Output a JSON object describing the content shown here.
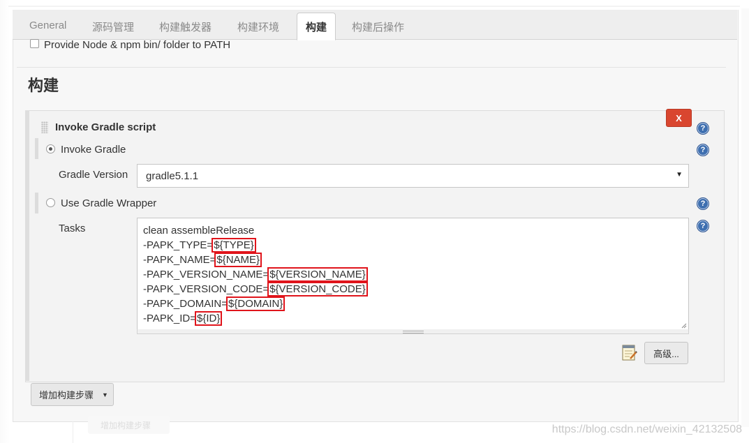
{
  "tabs": [
    "General",
    "源码管理",
    "构建触发器",
    "构建环境",
    "构建",
    "构建后操作"
  ],
  "active_tab_index": 4,
  "env_option": {
    "label": "Provide Node & npm bin/ folder to PATH",
    "checked": false
  },
  "section_title": "构建",
  "builder": {
    "title": "Invoke Gradle script",
    "delete_label": "X",
    "help_glyph": "?",
    "invoke_gradle": {
      "label": "Invoke Gradle",
      "selected": true
    },
    "gradle_version": {
      "label": "Gradle Version",
      "value": "gradle5.1.1"
    },
    "use_wrapper": {
      "label": "Use Gradle Wrapper",
      "selected": false
    },
    "tasks": {
      "label": "Tasks",
      "lines": [
        {
          "prefix": "clean assembleRelease",
          "var": ""
        },
        {
          "prefix": "-PAPK_TYPE=",
          "var": "${TYPE}"
        },
        {
          "prefix": "-PAPK_NAME=",
          "var": "${NAME}"
        },
        {
          "prefix": "-PAPK_VERSION_NAME=",
          "var": "${VERSION_NAME}"
        },
        {
          "prefix": "-PAPK_VERSION_CODE=",
          "var": "${VERSION_CODE}"
        },
        {
          "prefix": "-PAPK_DOMAIN=",
          "var": "${DOMAIN}"
        },
        {
          "prefix": "-PAPK_ID=",
          "var": "${ID}"
        }
      ]
    },
    "advanced_label": "高级...",
    "notepad_icon": "notepad-icon"
  },
  "add_step_label": "增加构建步骤",
  "ghost_add_step_label": "增加构建步骤",
  "watermark": "https://blog.csdn.net/weixin_42132508",
  "colors": {
    "highlight": "#e0141b",
    "delete_button": "#d9462f",
    "help_icon": "#3e6fb0"
  }
}
